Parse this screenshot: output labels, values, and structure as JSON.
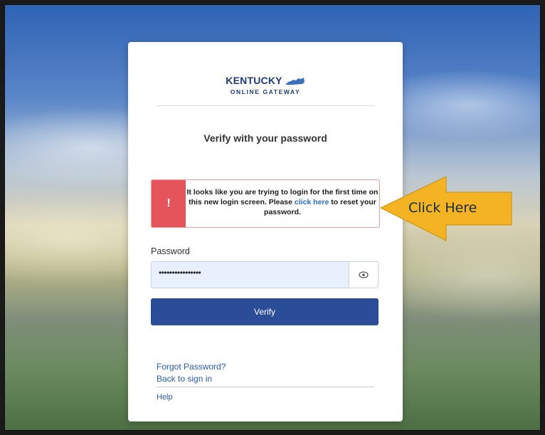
{
  "logo": {
    "line1": "KENTUCKY",
    "line2": "ONLINE GATEWAY"
  },
  "heading": "Verify with your password",
  "alert": {
    "icon": "!",
    "text_part1": "It looks like you are trying to login for the first time on this new login screen. Please ",
    "link_text": "click here",
    "text_part2": " to reset your password."
  },
  "password": {
    "label": "Password",
    "value": "••••••••••••••••"
  },
  "verify_label": "Verify",
  "links": {
    "forgot": "Forgot Password?",
    "back": "Back to sign in",
    "help": "Help"
  },
  "annotation": {
    "callout_text": "Click Here"
  },
  "colors": {
    "primary": "#2b4d98",
    "alert_red": "#e5545b",
    "link": "#2b5aa8",
    "callout": "#f3b323"
  },
  "icons": {
    "alert": "exclamation-icon",
    "eye": "eye-icon",
    "logo_shape": "kentucky-state-icon"
  }
}
